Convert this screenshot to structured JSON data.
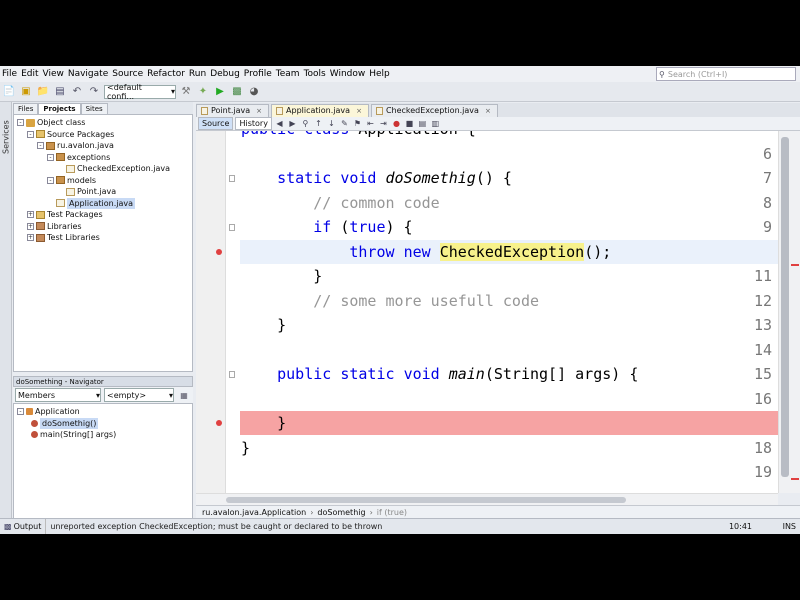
{
  "menubar": {
    "items": [
      "File",
      "Edit",
      "View",
      "Navigate",
      "Source",
      "Refactor",
      "Run",
      "Debug",
      "Profile",
      "Team",
      "Tools",
      "Window",
      "Help"
    ],
    "search_placeholder": "Search (Ctrl+I)"
  },
  "toolbar": {
    "config_combo": "<default confi..."
  },
  "sidebar": {
    "services_tab": "Services"
  },
  "projects": {
    "tabs": [
      "Files",
      "Projects",
      "Sites"
    ],
    "tree": [
      {
        "label": "Object class",
        "icon": "project-icon",
        "depth": 0,
        "toggle": "-"
      },
      {
        "label": "Source Packages",
        "icon": "folder-icon",
        "depth": 1,
        "toggle": "-"
      },
      {
        "label": "ru.avalon.java",
        "icon": "package-icon",
        "depth": 2,
        "toggle": "-"
      },
      {
        "label": "exceptions",
        "icon": "package-icon",
        "depth": 3,
        "toggle": "-"
      },
      {
        "label": "CheckedException.java",
        "icon": "java-file-icon",
        "depth": 4,
        "toggle": ""
      },
      {
        "label": "models",
        "icon": "package-icon",
        "depth": 3,
        "toggle": "-"
      },
      {
        "label": "Point.java",
        "icon": "java-file-icon",
        "depth": 4,
        "toggle": ""
      },
      {
        "label": "Application.java",
        "icon": "java-file-icon",
        "depth": 3,
        "toggle": "",
        "selected": true
      },
      {
        "label": "Test Packages",
        "icon": "folder-icon",
        "depth": 1,
        "toggle": "+"
      },
      {
        "label": "Libraries",
        "icon": "library-icon",
        "depth": 1,
        "toggle": "+"
      },
      {
        "label": "Test Libraries",
        "icon": "library-icon",
        "depth": 1,
        "toggle": "+"
      }
    ]
  },
  "navigator": {
    "title": "doSomething - Navigator",
    "members_combo": "Members",
    "filter_combo": "<empty>",
    "tree": [
      {
        "label": "Application",
        "depth": 0
      },
      {
        "label": "doSomethig()",
        "depth": 1,
        "selected": true
      },
      {
        "label": "main(String[] args)",
        "depth": 1
      }
    ]
  },
  "editor": {
    "tabs": [
      {
        "label": "Point.java",
        "active": false
      },
      {
        "label": "Application.java",
        "active": true
      },
      {
        "label": "CheckedException.java",
        "active": false
      }
    ],
    "view_source": "Source",
    "view_history": "History",
    "lines": [
      {
        "num": "",
        "parts": [
          [
            "kw",
            "public"
          ],
          [
            "t",
            " "
          ],
          [
            "kw",
            "class"
          ],
          [
            "t",
            " Application {"
          ]
        ]
      },
      {
        "num": "6",
        "parts": []
      },
      {
        "num": "7",
        "parts": [
          [
            "t",
            "    "
          ],
          [
            "kw",
            "static"
          ],
          [
            "t",
            " "
          ],
          [
            "kw",
            "void"
          ],
          [
            "t",
            " "
          ],
          [
            "m",
            "doSomethig"
          ],
          [
            "t",
            "() {"
          ]
        ]
      },
      {
        "num": "8",
        "parts": [
          [
            "t",
            "        "
          ],
          [
            "cm",
            "// common code"
          ]
        ]
      },
      {
        "num": "9",
        "parts": [
          [
            "t",
            "        "
          ],
          [
            "kw",
            "if"
          ],
          [
            "t",
            " ("
          ],
          [
            "kw",
            "true"
          ],
          [
            "t",
            ") {"
          ]
        ]
      },
      {
        "num": "",
        "parts": [
          [
            "t",
            "            "
          ],
          [
            "kw",
            "throw"
          ],
          [
            "t",
            " "
          ],
          [
            "kw",
            "new"
          ],
          [
            "t",
            " "
          ],
          [
            "hl",
            "CheckedException"
          ],
          [
            "t",
            "()"
          ],
          [
            "t",
            ";"
          ]
        ]
      },
      {
        "num": "11",
        "parts": [
          [
            "t",
            "        }"
          ]
        ]
      },
      {
        "num": "12",
        "parts": [
          [
            "t",
            "        "
          ],
          [
            "cm",
            "// some more usefull code"
          ]
        ]
      },
      {
        "num": "13",
        "parts": [
          [
            "t",
            "    }"
          ]
        ]
      },
      {
        "num": "14",
        "parts": []
      },
      {
        "num": "15",
        "parts": [
          [
            "t",
            "    "
          ],
          [
            "kw",
            "public"
          ],
          [
            "t",
            " "
          ],
          [
            "kw",
            "static"
          ],
          [
            "t",
            " "
          ],
          [
            "kw",
            "void"
          ],
          [
            "t",
            " "
          ],
          [
            "m",
            "main"
          ],
          [
            "t",
            "(String[] args) {"
          ]
        ]
      },
      {
        "num": "16",
        "parts": []
      },
      {
        "num": "",
        "parts": [
          [
            "t",
            "    }"
          ]
        ]
      },
      {
        "num": "18",
        "parts": [
          [
            "t",
            "}"
          ]
        ]
      },
      {
        "num": "19",
        "parts": []
      }
    ]
  },
  "breadcrumbs": [
    "ru.avalon.java.Application",
    "doSomethig",
    "if (true)"
  ],
  "status": {
    "output_label": "Output",
    "message": "unreported exception CheckedException; must be caught or declared to be thrown",
    "position": "10:41",
    "mode": "INS"
  },
  "colors": {
    "keyword": "#0000e6",
    "comment": "#969696",
    "error_line": "#f6a3a3",
    "highlight": "#f7f18b"
  }
}
